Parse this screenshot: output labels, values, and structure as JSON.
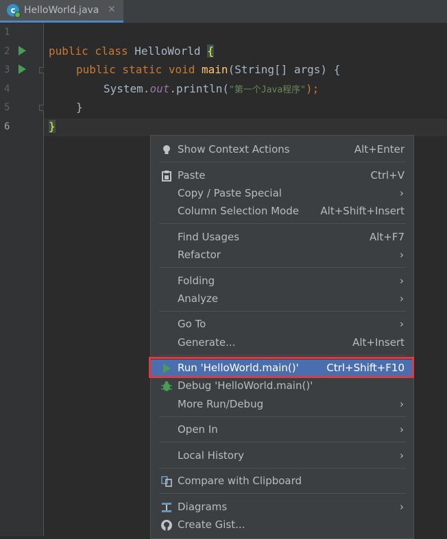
{
  "tab": {
    "icon_letter": "c",
    "label": "HelloWorld.java",
    "close": "✕"
  },
  "line_numbers": [
    "1",
    "2",
    "3",
    "4",
    "5",
    "6"
  ],
  "code": {
    "l2": {
      "kw": "public class ",
      "name": "HelloWorld ",
      "brace": "{"
    },
    "l3": {
      "kw": "public static void ",
      "fn": "main",
      "rest": "(String[] args) {"
    },
    "l4": {
      "pre": "System.",
      "field": "out",
      "call": ".println(",
      "str": "\"第一个Java程序\"",
      "end": ");"
    },
    "l5": {
      "text": "}"
    },
    "l6": {
      "brace": "}"
    }
  },
  "menu": {
    "show_context_actions": {
      "label": "Show Context Actions",
      "shortcut": "Alt+Enter"
    },
    "paste": {
      "label": "Paste",
      "shortcut": "Ctrl+V"
    },
    "copy_paste_special": {
      "label": "Copy / Paste Special",
      "arrow": "›"
    },
    "column_selection_mode": {
      "label": "Column Selection Mode",
      "shortcut": "Alt+Shift+Insert"
    },
    "find_usages": {
      "label": "Find Usages",
      "shortcut": "Alt+F7"
    },
    "refactor": {
      "label": "Refactor",
      "arrow": "›"
    },
    "folding": {
      "label": "Folding",
      "arrow": "›"
    },
    "analyze": {
      "label": "Analyze",
      "arrow": "›"
    },
    "go_to": {
      "label": "Go To",
      "arrow": "›"
    },
    "generate": {
      "label": "Generate...",
      "shortcut": "Alt+Insert"
    },
    "run": {
      "label": "Run 'HelloWorld.main()'",
      "shortcut": "Ctrl+Shift+F10"
    },
    "debug": {
      "label": "Debug 'HelloWorld.main()'"
    },
    "more_run_debug": {
      "label": "More Run/Debug",
      "arrow": "›"
    },
    "open_in": {
      "label": "Open In",
      "arrow": "›"
    },
    "local_history": {
      "label": "Local History",
      "arrow": "›"
    },
    "compare_clipboard": {
      "label": "Compare with Clipboard"
    },
    "diagrams": {
      "label": "Diagrams",
      "arrow": "›"
    },
    "create_gist": {
      "label": "Create Gist..."
    }
  },
  "colors": {
    "selected": "#4b6eaf",
    "highlight_border": "#e0393e",
    "run_green": "#499c54"
  }
}
